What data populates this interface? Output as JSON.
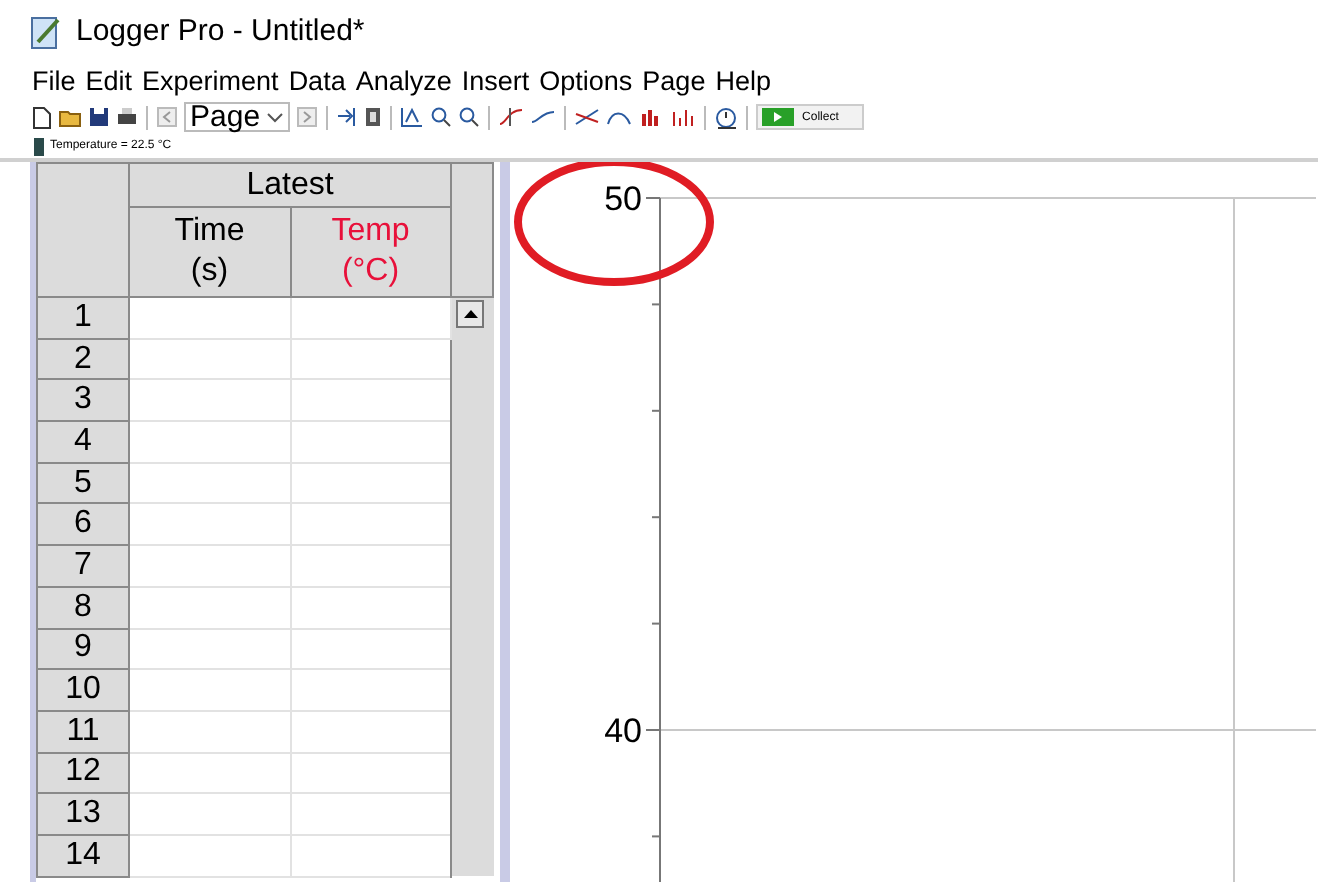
{
  "window": {
    "title": "Logger Pro - Untitled*"
  },
  "menu": [
    "File",
    "Edit",
    "Experiment",
    "Data",
    "Analyze",
    "Insert",
    "Options",
    "Page",
    "Help"
  ],
  "toolbar": {
    "page_select": "Page",
    "collect": "Collect"
  },
  "meter": {
    "reading": "Temperature = 22.5 °C"
  },
  "table": {
    "group": "Latest",
    "columns": [
      {
        "name": "Time",
        "unit": "(s)",
        "color": "#000000"
      },
      {
        "name": "Temp",
        "unit": "(°C)",
        "color": "#e8103a"
      }
    ],
    "rows": [
      "1",
      "2",
      "3",
      "4",
      "5",
      "6",
      "7",
      "8",
      "9",
      "10",
      "11",
      "12",
      "13",
      "14"
    ]
  },
  "graph": {
    "y_axis_labels": [
      "50",
      "40"
    ]
  }
}
